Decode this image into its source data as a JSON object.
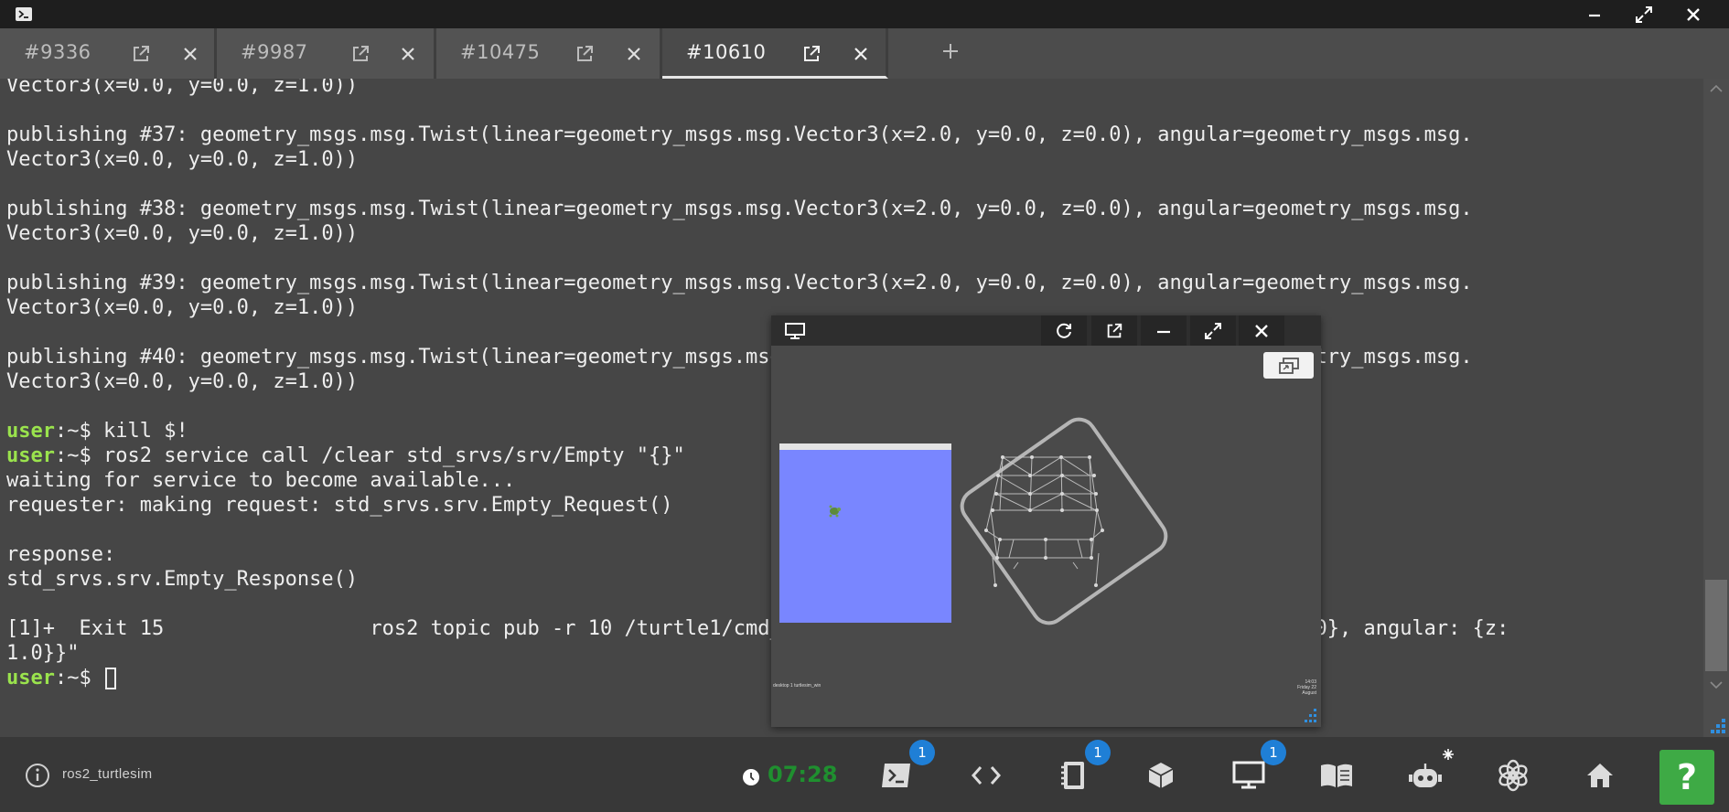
{
  "tabs": [
    {
      "label": "#9336",
      "active": false
    },
    {
      "label": "#9987",
      "active": false
    },
    {
      "label": "#10475",
      "active": false
    },
    {
      "label": "#10610",
      "active": true
    }
  ],
  "terminal": {
    "lines": [
      {
        "text": "Vector3(x=0.0, y=0.0, z=1.0))"
      },
      {
        "text": ""
      },
      {
        "text": "publishing #37: geometry_msgs.msg.Twist(linear=geometry_msgs.msg.Vector3(x=2.0, y=0.0, z=0.0), angular=geometry_msgs.msg."
      },
      {
        "text": "Vector3(x=0.0, y=0.0, z=1.0))"
      },
      {
        "text": ""
      },
      {
        "text": "publishing #38: geometry_msgs.msg.Twist(linear=geometry_msgs.msg.Vector3(x=2.0, y=0.0, z=0.0), angular=geometry_msgs.msg."
      },
      {
        "text": "Vector3(x=0.0, y=0.0, z=1.0))"
      },
      {
        "text": ""
      },
      {
        "text": "publishing #39: geometry_msgs.msg.Twist(linear=geometry_msgs.msg.Vector3(x=2.0, y=0.0, z=0.0), angular=geometry_msgs.msg."
      },
      {
        "text": "Vector3(x=0.0, y=0.0, z=1.0))"
      },
      {
        "text": ""
      },
      {
        "text": "publishing #40: geometry_msgs.msg.Twist(linear=geometry_msgs.msg.Vector3(x=2.0, y=0.0, z=0.0), angular=geometry_msgs.msg."
      },
      {
        "text": "Vector3(x=0.0, y=0.0, z=1.0))"
      },
      {
        "text": ""
      },
      {
        "prompt": "user",
        "sep": ":~$ ",
        "text": "kill $!"
      },
      {
        "prompt": "user",
        "sep": ":~$ ",
        "text": "ros2 service call /clear std_srvs/srv/Empty \"{}\""
      },
      {
        "text": "waiting for service to become available..."
      },
      {
        "text": "requester: making request: std_srvs.srv.Empty_Request()"
      },
      {
        "text": ""
      },
      {
        "text": "response:"
      },
      {
        "text": "std_srvs.srv.Empty_Response()"
      },
      {
        "text": ""
      },
      {
        "text": "[1]+  Exit 15                 ros2 topic pub -r 10 /turtle1/cmd_vel geometry_msgs/msg/Twist \"{linear: {x: 2.0}, angular: {z:"
      },
      {
        "text": "1.0}}\""
      },
      {
        "prompt": "user",
        "sep": ":~$ ",
        "text": "",
        "cursor": true
      }
    ]
  },
  "vnc": {
    "taskbar_left": "desktop 1   turtlesim_win",
    "clock_time": "14:03",
    "clock_date": "Friday 22 August"
  },
  "bottombar": {
    "project_name": "ros2_turtlesim",
    "timer": "07:28",
    "badges": {
      "terminal": "1",
      "notebook": "1",
      "desktop": "1"
    },
    "help_label": "?"
  },
  "colors": {
    "prompt_user": "#9ae34d",
    "timer": "#1f8f2f",
    "badge": "#1f7fd6",
    "help": "#3eaa45",
    "turtlesim_bg": "#7986ff"
  }
}
